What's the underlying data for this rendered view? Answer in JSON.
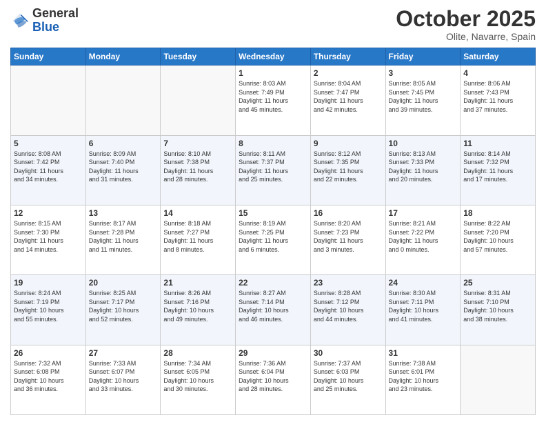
{
  "logo": {
    "general": "General",
    "blue": "Blue"
  },
  "header": {
    "month": "October 2025",
    "location": "Olite, Navarre, Spain"
  },
  "days_of_week": [
    "Sunday",
    "Monday",
    "Tuesday",
    "Wednesday",
    "Thursday",
    "Friday",
    "Saturday"
  ],
  "weeks": [
    [
      {
        "day": "",
        "info": ""
      },
      {
        "day": "",
        "info": ""
      },
      {
        "day": "",
        "info": ""
      },
      {
        "day": "1",
        "info": "Sunrise: 8:03 AM\nSunset: 7:49 PM\nDaylight: 11 hours\nand 45 minutes."
      },
      {
        "day": "2",
        "info": "Sunrise: 8:04 AM\nSunset: 7:47 PM\nDaylight: 11 hours\nand 42 minutes."
      },
      {
        "day": "3",
        "info": "Sunrise: 8:05 AM\nSunset: 7:45 PM\nDaylight: 11 hours\nand 39 minutes."
      },
      {
        "day": "4",
        "info": "Sunrise: 8:06 AM\nSunset: 7:43 PM\nDaylight: 11 hours\nand 37 minutes."
      }
    ],
    [
      {
        "day": "5",
        "info": "Sunrise: 8:08 AM\nSunset: 7:42 PM\nDaylight: 11 hours\nand 34 minutes."
      },
      {
        "day": "6",
        "info": "Sunrise: 8:09 AM\nSunset: 7:40 PM\nDaylight: 11 hours\nand 31 minutes."
      },
      {
        "day": "7",
        "info": "Sunrise: 8:10 AM\nSunset: 7:38 PM\nDaylight: 11 hours\nand 28 minutes."
      },
      {
        "day": "8",
        "info": "Sunrise: 8:11 AM\nSunset: 7:37 PM\nDaylight: 11 hours\nand 25 minutes."
      },
      {
        "day": "9",
        "info": "Sunrise: 8:12 AM\nSunset: 7:35 PM\nDaylight: 11 hours\nand 22 minutes."
      },
      {
        "day": "10",
        "info": "Sunrise: 8:13 AM\nSunset: 7:33 PM\nDaylight: 11 hours\nand 20 minutes."
      },
      {
        "day": "11",
        "info": "Sunrise: 8:14 AM\nSunset: 7:32 PM\nDaylight: 11 hours\nand 17 minutes."
      }
    ],
    [
      {
        "day": "12",
        "info": "Sunrise: 8:15 AM\nSunset: 7:30 PM\nDaylight: 11 hours\nand 14 minutes."
      },
      {
        "day": "13",
        "info": "Sunrise: 8:17 AM\nSunset: 7:28 PM\nDaylight: 11 hours\nand 11 minutes."
      },
      {
        "day": "14",
        "info": "Sunrise: 8:18 AM\nSunset: 7:27 PM\nDaylight: 11 hours\nand 8 minutes."
      },
      {
        "day": "15",
        "info": "Sunrise: 8:19 AM\nSunset: 7:25 PM\nDaylight: 11 hours\nand 6 minutes."
      },
      {
        "day": "16",
        "info": "Sunrise: 8:20 AM\nSunset: 7:23 PM\nDaylight: 11 hours\nand 3 minutes."
      },
      {
        "day": "17",
        "info": "Sunrise: 8:21 AM\nSunset: 7:22 PM\nDaylight: 11 hours\nand 0 minutes."
      },
      {
        "day": "18",
        "info": "Sunrise: 8:22 AM\nSunset: 7:20 PM\nDaylight: 10 hours\nand 57 minutes."
      }
    ],
    [
      {
        "day": "19",
        "info": "Sunrise: 8:24 AM\nSunset: 7:19 PM\nDaylight: 10 hours\nand 55 minutes."
      },
      {
        "day": "20",
        "info": "Sunrise: 8:25 AM\nSunset: 7:17 PM\nDaylight: 10 hours\nand 52 minutes."
      },
      {
        "day": "21",
        "info": "Sunrise: 8:26 AM\nSunset: 7:16 PM\nDaylight: 10 hours\nand 49 minutes."
      },
      {
        "day": "22",
        "info": "Sunrise: 8:27 AM\nSunset: 7:14 PM\nDaylight: 10 hours\nand 46 minutes."
      },
      {
        "day": "23",
        "info": "Sunrise: 8:28 AM\nSunset: 7:12 PM\nDaylight: 10 hours\nand 44 minutes."
      },
      {
        "day": "24",
        "info": "Sunrise: 8:30 AM\nSunset: 7:11 PM\nDaylight: 10 hours\nand 41 minutes."
      },
      {
        "day": "25",
        "info": "Sunrise: 8:31 AM\nSunset: 7:10 PM\nDaylight: 10 hours\nand 38 minutes."
      }
    ],
    [
      {
        "day": "26",
        "info": "Sunrise: 7:32 AM\nSunset: 6:08 PM\nDaylight: 10 hours\nand 36 minutes."
      },
      {
        "day": "27",
        "info": "Sunrise: 7:33 AM\nSunset: 6:07 PM\nDaylight: 10 hours\nand 33 minutes."
      },
      {
        "day": "28",
        "info": "Sunrise: 7:34 AM\nSunset: 6:05 PM\nDaylight: 10 hours\nand 30 minutes."
      },
      {
        "day": "29",
        "info": "Sunrise: 7:36 AM\nSunset: 6:04 PM\nDaylight: 10 hours\nand 28 minutes."
      },
      {
        "day": "30",
        "info": "Sunrise: 7:37 AM\nSunset: 6:03 PM\nDaylight: 10 hours\nand 25 minutes."
      },
      {
        "day": "31",
        "info": "Sunrise: 7:38 AM\nSunset: 6:01 PM\nDaylight: 10 hours\nand 23 minutes."
      },
      {
        "day": "",
        "info": ""
      }
    ]
  ]
}
